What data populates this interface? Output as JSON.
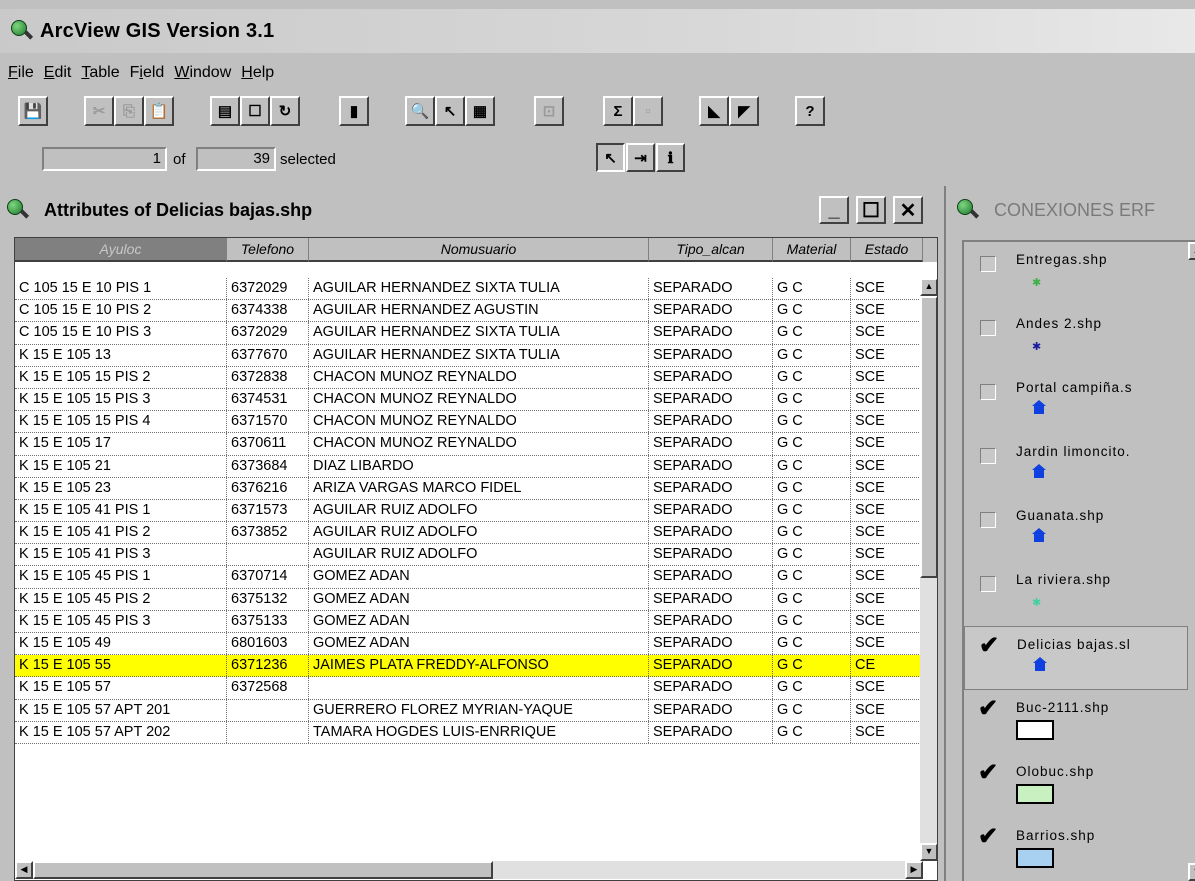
{
  "app": {
    "title": "ArcView GIS Version 3.1"
  },
  "menu": [
    {
      "label": "File",
      "u": "F",
      "rest": "ile"
    },
    {
      "label": "Edit",
      "u": "E",
      "rest": "dit"
    },
    {
      "label": "Table",
      "u": "T",
      "rest": "able"
    },
    {
      "label": "Field",
      "pre": "F",
      "u": "i",
      "rest": "eld"
    },
    {
      "label": "Window",
      "u": "W",
      "rest": "indow"
    },
    {
      "label": "Help",
      "u": "H",
      "rest": "elp"
    }
  ],
  "toolbar": {
    "buttons": [
      {
        "name": "save-icon",
        "glyph": "💾"
      },
      {
        "name": "cut-icon",
        "glyph": "✂"
      },
      {
        "name": "copy-icon",
        "glyph": "⎘"
      },
      {
        "name": "paste-icon",
        "glyph": "📋"
      },
      {
        "name": "table-properties-icon",
        "glyph": "▤"
      },
      {
        "name": "select-none-icon",
        "glyph": "☐"
      },
      {
        "name": "refresh-icon",
        "glyph": "↻"
      },
      {
        "name": "chart-icon",
        "glyph": "▮"
      },
      {
        "name": "find-icon",
        "glyph": "🔍"
      },
      {
        "name": "query-icon",
        "glyph": "↖"
      },
      {
        "name": "select-all-icon",
        "glyph": "▦"
      },
      {
        "name": "promote-icon",
        "glyph": "⊡"
      },
      {
        "name": "summarize-icon",
        "glyph": "Σ"
      },
      {
        "name": "calculate-icon",
        "glyph": "▫"
      },
      {
        "name": "sort-ascending-icon",
        "glyph": "◣"
      },
      {
        "name": "sort-descending-icon",
        "glyph": "◤"
      },
      {
        "name": "help-pointer-icon",
        "glyph": "?"
      }
    ]
  },
  "status": {
    "current": "1",
    "of_label": "of",
    "selected": "39",
    "selected_label": "selected"
  },
  "tools": [
    {
      "name": "pointer-tool-icon",
      "glyph": "↖"
    },
    {
      "name": "edit-tool-icon",
      "glyph": "⇥"
    },
    {
      "name": "identify-tool-icon",
      "glyph": "ℹ"
    }
  ],
  "table_window": {
    "title": "Attributes of Delicias bajas.shp"
  },
  "table": {
    "columns": [
      "Ayuloc",
      "Telefono",
      "Nomusuario",
      "Tipo_alcan",
      "Material",
      "Estado"
    ],
    "rows": [
      [
        "C 105 15 E 10 PIS 1",
        "6372029",
        "AGUILAR HERNANDEZ SIXTA TULIA",
        "SEPARADO",
        "G C",
        "SCE"
      ],
      [
        "C 105 15 E 10 PIS 2",
        "6374338",
        "AGUILAR HERNANDEZ AGUSTIN",
        "SEPARADO",
        "G C",
        "SCE"
      ],
      [
        "C 105 15 E 10 PIS 3",
        "6372029",
        "AGUILAR HERNANDEZ SIXTA TULIA",
        "SEPARADO",
        "G C",
        "SCE"
      ],
      [
        "K 15 E 105 13",
        "6377670",
        "AGUILAR HERNANDEZ SIXTA TULIA",
        "SEPARADO",
        "G C",
        "SCE"
      ],
      [
        "K 15 E 105 15 PIS 2",
        "6372838",
        "CHACON MUNOZ REYNALDO",
        "SEPARADO",
        "G C",
        "SCE"
      ],
      [
        "K 15 E 105 15 PIS 3",
        "6374531",
        "CHACON MUNOZ REYNALDO",
        "SEPARADO",
        "G C",
        "SCE"
      ],
      [
        "K 15 E 105 15 PIS 4",
        "6371570",
        "CHACON MUNOZ REYNALDO",
        "SEPARADO",
        "G C",
        "SCE"
      ],
      [
        "K 15 E 105 17",
        "6370611",
        "CHACON MUNOZ REYNALDO",
        "SEPARADO",
        "G C",
        "SCE"
      ],
      [
        "K 15 E 105 21",
        "6373684",
        "DIAZ LIBARDO",
        "SEPARADO",
        "G C",
        "SCE"
      ],
      [
        "K 15 E 105 23",
        "6376216",
        "ARIZA VARGAS MARCO FIDEL",
        "SEPARADO",
        "G C",
        "SCE"
      ],
      [
        "K 15 E 105 41 PIS 1",
        "6371573",
        "AGUILAR RUIZ ADOLFO",
        "SEPARADO",
        "G C",
        "SCE"
      ],
      [
        "K 15 E 105 41 PIS 2",
        "6373852",
        "AGUILAR RUIZ ADOLFO",
        "SEPARADO",
        "G C",
        "SCE"
      ],
      [
        "K 15 E 105 41 PIS 3",
        "",
        "AGUILAR RUIZ ADOLFO",
        "SEPARADO",
        "G C",
        "SCE"
      ],
      [
        "K 15 E 105 45 PIS 1",
        "6370714",
        "GOMEZ ADAN",
        "SEPARADO",
        "G C",
        "SCE"
      ],
      [
        "K 15 E 105 45 PIS 2",
        "6375132",
        "GOMEZ ADAN",
        "SEPARADO",
        "G C",
        "SCE"
      ],
      [
        "K 15 E 105 45 PIS 3",
        "6375133",
        "GOMEZ ADAN",
        "SEPARADO",
        "G C",
        "SCE"
      ],
      [
        "K 15 E 105 49",
        "6801603",
        "GOMEZ ADAN",
        "SEPARADO",
        "G C",
        "SCE"
      ],
      [
        "K 15 E 105 55",
        "6371236",
        "JAIMES PLATA FREDDY-ALFONSO",
        "SEPARADO",
        "G C",
        "CE"
      ],
      [
        "K 15 E 105 57",
        "6372568",
        "",
        "SEPARADO",
        "G C",
        "SCE"
      ],
      [
        "K 15 E 105 57 APT 201",
        "",
        "GUERRERO FLOREZ MYRIAN-YAQUE",
        "SEPARADO",
        "G C",
        "SCE"
      ],
      [
        "K 15 E 105 57 APT 202",
        "",
        "TAMARA HOGDES LUIS-ENRRIQUE",
        "SEPARADO",
        "G C",
        "SCE"
      ]
    ],
    "highlight_row": 17,
    "highlight_color": "#ffff00"
  },
  "toc": {
    "title": "CONEXIONES ERF",
    "themes": [
      {
        "name": "Entregas.shp",
        "checked": false,
        "symbol": "point",
        "color": "#3cb043"
      },
      {
        "name": "Andes 2.shp",
        "checked": false,
        "symbol": "point",
        "color": "#1a1aa0"
      },
      {
        "name": "Portal campiña.s",
        "checked": false,
        "symbol": "house",
        "color": "#1040e0"
      },
      {
        "name": "Jardin limoncito.",
        "checked": false,
        "symbol": "house",
        "color": "#1040e0"
      },
      {
        "name": "Guanata.shp",
        "checked": false,
        "symbol": "house",
        "color": "#1040e0"
      },
      {
        "name": "La riviera.shp",
        "checked": false,
        "symbol": "point",
        "color": "#40d0a0"
      },
      {
        "name": "Delicias bajas.sl",
        "checked": true,
        "symbol": "house",
        "color": "#1040e0",
        "active": true
      },
      {
        "name": "Buc-2111.shp",
        "checked": true,
        "symbol": "rect",
        "color": "#ffffff"
      },
      {
        "name": "Olobuc.shp",
        "checked": true,
        "symbol": "rect",
        "color": "#c8f0c0"
      },
      {
        "name": "Barrios.shp",
        "checked": true,
        "symbol": "rect",
        "color": "#a8d0f0"
      }
    ]
  }
}
